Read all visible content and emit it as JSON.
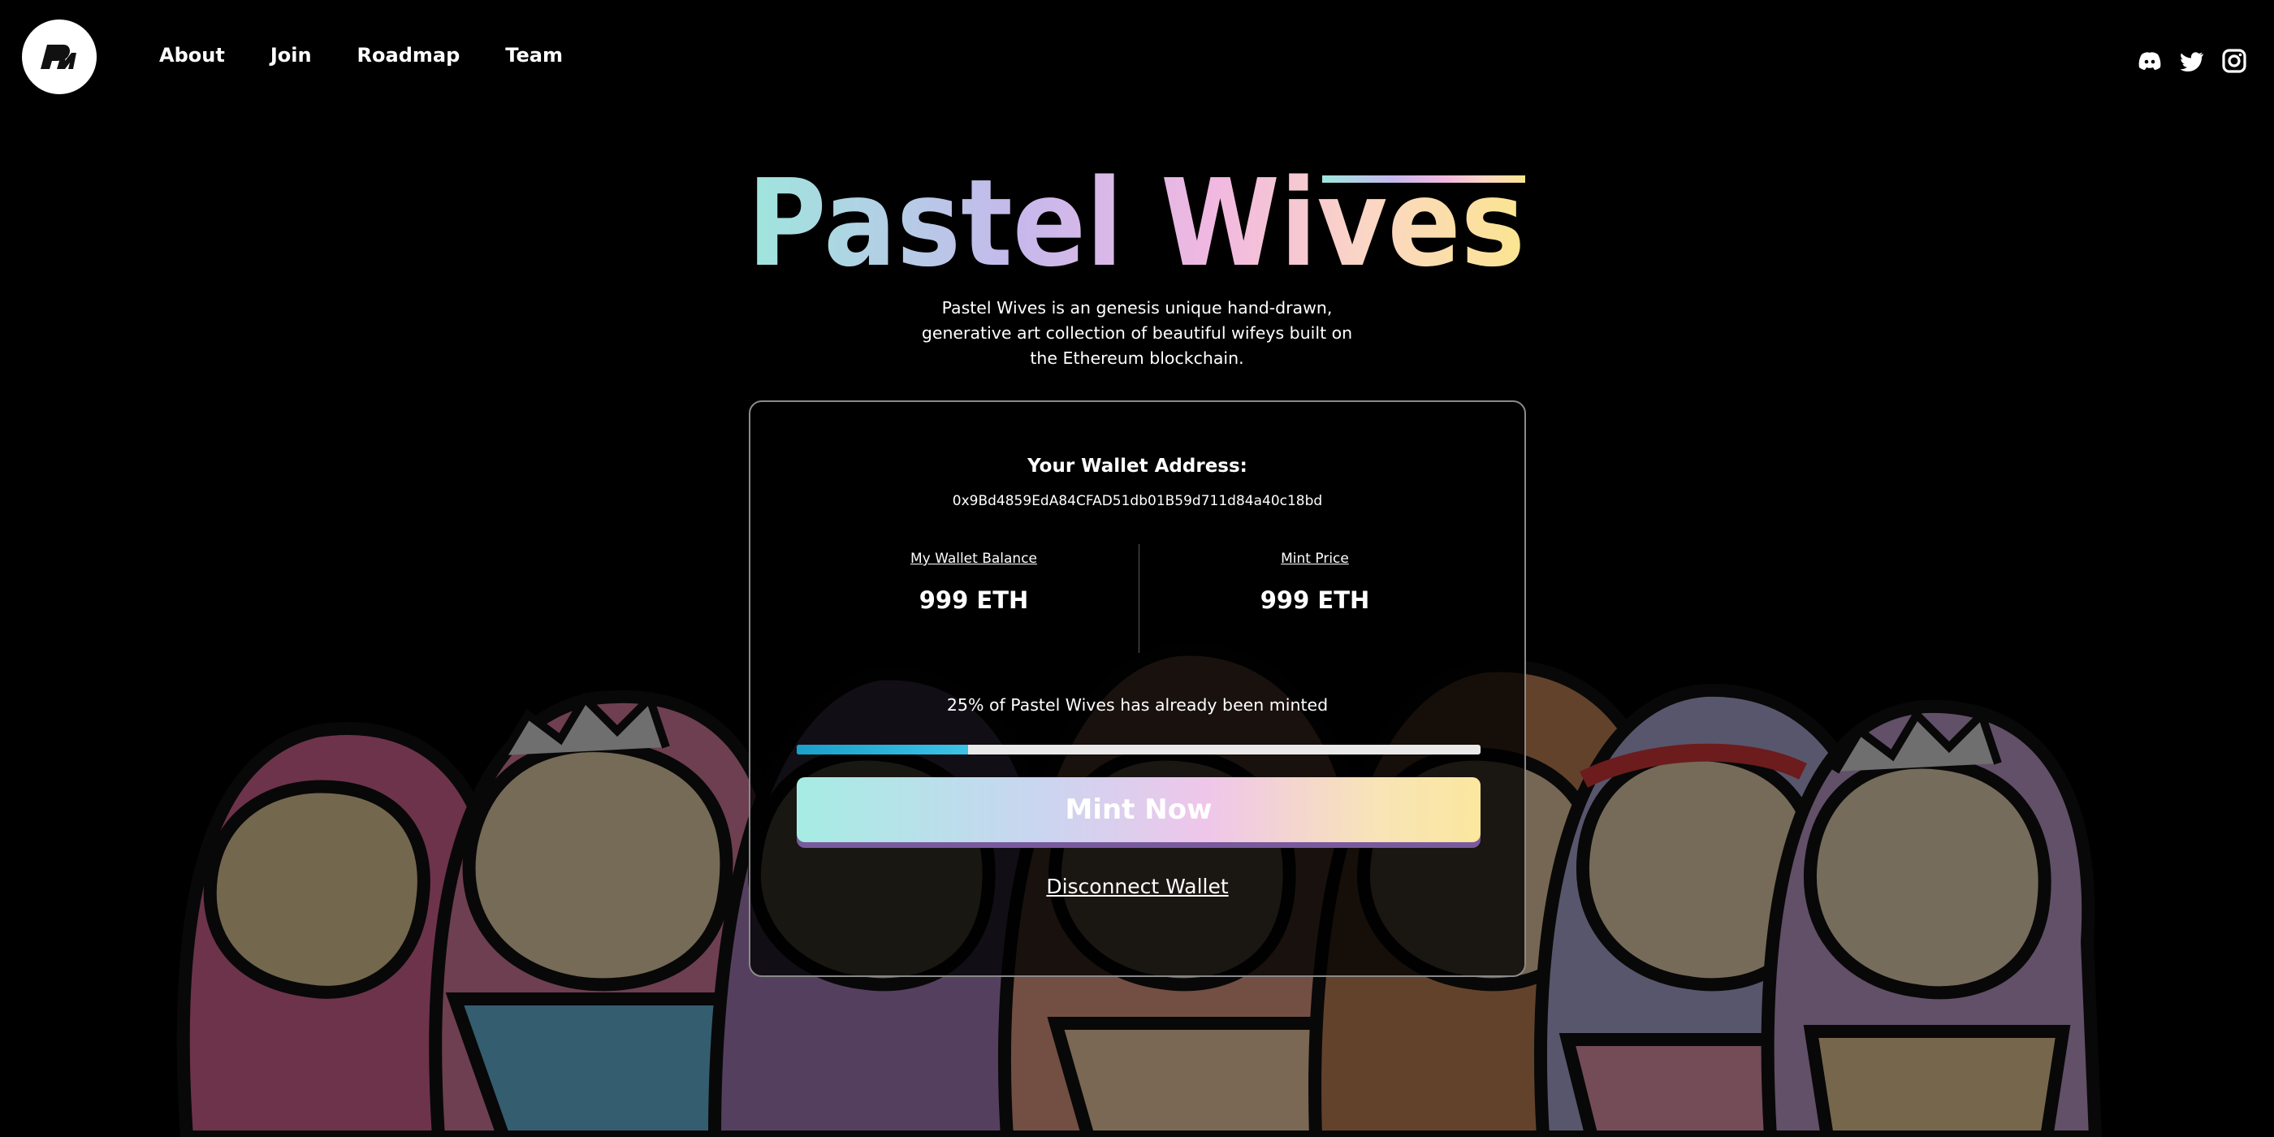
{
  "header": {
    "logo_icon": "pastel-wives-logo",
    "nav": [
      {
        "label": "About"
      },
      {
        "label": "Join"
      },
      {
        "label": "Roadmap"
      },
      {
        "label": "Team"
      }
    ],
    "socials": [
      "discord-icon",
      "twitter-icon",
      "instagram-icon"
    ]
  },
  "hero": {
    "title": "Pastel Wives",
    "description": "Pastel Wives is an genesis unique hand-drawn, generative art collection of beautiful wifeys built on the Ethereum blockchain."
  },
  "mint_card": {
    "wallet_label": "Your Wallet Address:",
    "wallet_address": "0x9Bd4859EdA84CFAD51db01B59d711d84a40c18bd",
    "balance_label": "My Wallet Balance",
    "balance_value": "999 ETH",
    "price_label": "Mint Price",
    "price_value": "999 ETH",
    "minted_text": "25% of Pastel Wives has already been minted",
    "minted_fraction": 0.25,
    "mint_button": "Mint Now",
    "disconnect": "Disconnect Wallet"
  },
  "colors": {
    "background": "#000000",
    "progress_fill": "#1aa0c9",
    "title_gradient": [
      "#9fe6dd",
      "#c6b8ec",
      "#f1b8e1",
      "#fbe58f"
    ]
  }
}
